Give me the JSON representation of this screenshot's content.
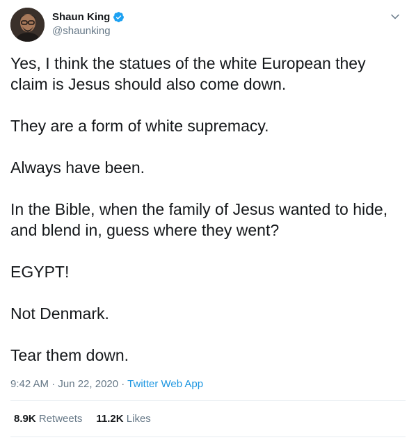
{
  "user": {
    "display_name": "Shaun King",
    "handle": "@shaunking"
  },
  "tweet": {
    "paragraphs": [
      "Yes, I think the statues of the white European they claim is Jesus should also come down.",
      "They are a form of white supremacy.",
      "Always have been.",
      "In the Bible, when the family of Jesus wanted to hide, and blend in, guess where they went?",
      "EGYPT!",
      "Not Denmark.",
      "Tear them down."
    ],
    "timestamp": "9:42 AM · Jun 22, 2020 · ",
    "source": "Twitter Web App"
  },
  "stats": {
    "retweets_count": "8.9K",
    "retweets_label": "Retweets",
    "likes_count": "11.2K",
    "likes_label": "Likes"
  },
  "colors": {
    "accent": "#1b95e0",
    "verified": "#1da1f2",
    "secondary_text": "#657786"
  },
  "icons": {
    "verified": "verified-badge-icon",
    "more": "chevron-down-icon"
  }
}
